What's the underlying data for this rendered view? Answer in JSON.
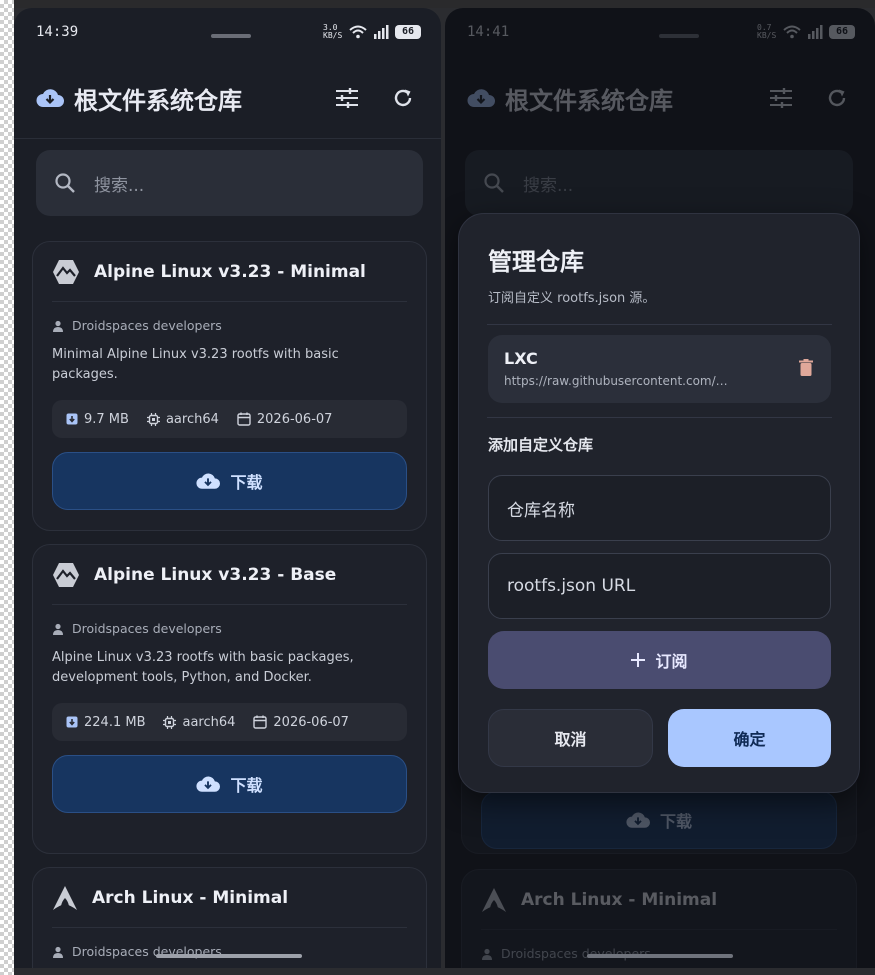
{
  "left": {
    "time": "14:39",
    "net_speed": "3.0 KB/S",
    "battery": "66",
    "title": "根文件系统仓库",
    "search_placeholder": "搜索...",
    "cards": [
      {
        "name": "Alpine Linux v3.23 - Minimal",
        "author": "Droidspaces developers",
        "desc": "Minimal Alpine Linux v3.23 rootfs with basic packages.",
        "size": "9.7 MB",
        "arch": "aarch64",
        "date": "2026-06-07",
        "download": "下载"
      },
      {
        "name": "Alpine Linux v3.23 - Base",
        "author": "Droidspaces developers",
        "desc": "Alpine Linux v3.23 rootfs with basic packages, development tools, Python, and Docker.",
        "size": "224.1 MB",
        "arch": "aarch64",
        "date": "2026-06-07",
        "download": "下载"
      },
      {
        "name": "Arch Linux - Minimal",
        "author": "Droidspaces developers"
      }
    ]
  },
  "right": {
    "time": "14:41",
    "net_speed": "0.7 KB/S",
    "battery": "66",
    "title": "根文件系统仓库",
    "search_placeholder": "搜索...",
    "bg_download": "下载",
    "bg_card_name": "Arch Linux - Minimal",
    "bg_card_author": "Droidspaces developers",
    "dialog": {
      "title": "管理仓库",
      "subtitle": "订阅自定义 rootfs.json 源。",
      "repo_name": "LXC",
      "repo_url": "https://raw.githubusercontent.com/…",
      "add_heading": "添加自定义仓库",
      "name_placeholder": "仓库名称",
      "url_placeholder": "rootfs.json URL",
      "subscribe": "订阅",
      "cancel": "取消",
      "ok": "确定"
    }
  }
}
